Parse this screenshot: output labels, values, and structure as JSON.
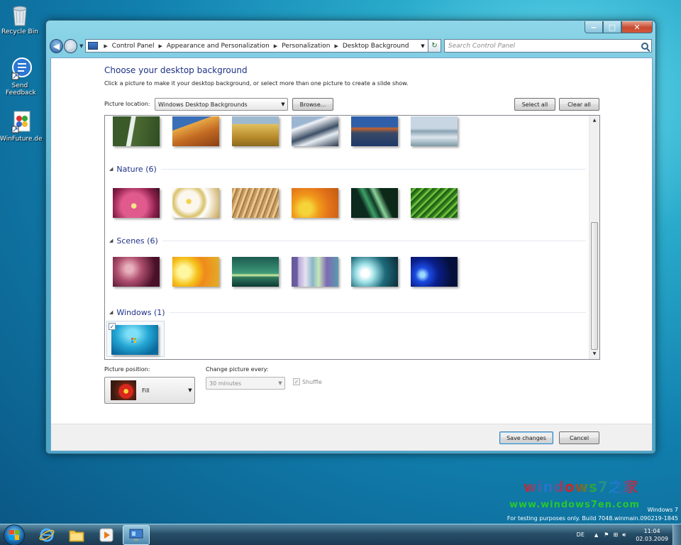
{
  "desktop": {
    "icons": [
      {
        "label": "Recycle Bin"
      },
      {
        "label": "Send Feedback"
      },
      {
        "label": "WinFuture.de"
      }
    ],
    "branding": {
      "os_name": "Windows 7",
      "build_text": "For testing purposes only. Build 7048.winmain.090219-1845",
      "watermark_title": "windows7之家",
      "watermark_url": "www.windows7en.com"
    }
  },
  "window": {
    "caption_buttons": {
      "minimize": "‒",
      "maximize": "□",
      "close": "✕"
    },
    "nav": {
      "breadcrumbs": [
        "Control Panel",
        "Appearance and Personalization",
        "Personalization",
        "Desktop Background"
      ],
      "search_placeholder": "Search Control Panel"
    },
    "content": {
      "heading": "Choose your desktop background",
      "description": "Click a picture to make it your desktop background, or select more than one picture to create a slide show.",
      "picture_location_label": "Picture location:",
      "picture_location_value": "Windows Desktop Backgrounds",
      "browse_label": "Browse...",
      "select_all_label": "Select all",
      "clear_all_label": "Clear all",
      "groups": [
        {
          "title": "Nature (6)"
        },
        {
          "title": "Scenes (6)"
        },
        {
          "title": "Windows (1)"
        }
      ],
      "windows_item_checked": true,
      "picture_position_label": "Picture position:",
      "picture_position_value": "Fill",
      "change_picture_label": "Change picture every:",
      "change_picture_value": "30 minutes",
      "shuffle_label": "Shuffle",
      "shuffle_checked": true
    },
    "footer": {
      "save_label": "Save changes",
      "cancel_label": "Cancel"
    }
  },
  "taskbar": {
    "language": "DE",
    "time": "11:04",
    "date": "02.03.2009"
  }
}
